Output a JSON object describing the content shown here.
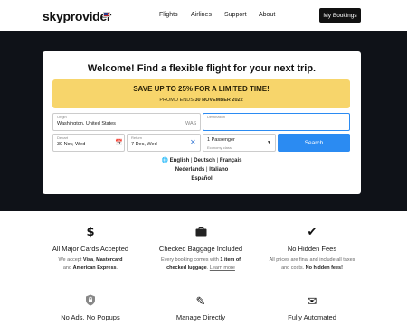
{
  "brand": {
    "name": "skyprovider",
    "flag": "us-flag-icon"
  },
  "nav": {
    "flights": "Flights",
    "airlines": "Airlines",
    "support": "Support",
    "about": "About",
    "my_bookings": "My Bookings"
  },
  "hero": {
    "welcome": "Welcome! Find a flexible flight for your next trip.",
    "promo_title": "SAVE UP TO 25% FOR A LIMITED TIME!",
    "promo_prefix": "PROMO ENDS ",
    "promo_date": "30 NOVEMBER 2022"
  },
  "form": {
    "origin_label": "Origin",
    "origin_value": "Washington, United States",
    "origin_code": "WAS",
    "destination_label": "Destination",
    "destination_value": "",
    "depart_label": "Depart",
    "depart_value": "30 Nov, Wed",
    "return_label": "Return",
    "return_value": "7 Dec, Wed",
    "passengers_value": "1 Passenger",
    "class_value": "Economy class",
    "search_label": "Search"
  },
  "languages": {
    "english": "English",
    "deutsch": "Deutsch",
    "francais": "Français",
    "nederlands": "Nederlands",
    "italiano": "Italiano",
    "espanol": "Español"
  },
  "features": [
    {
      "icon": "dollar-icon",
      "title": "All Major Cards Accepted",
      "d1": "We accept ",
      "b1": "Visa",
      "d2": ", ",
      "b2": "Mastercard",
      "d3": "and ",
      "b3": "American Express",
      "d4": "."
    },
    {
      "icon": "baggage-icon",
      "title": "Checked Baggage Included",
      "d1": "Every booking comes with ",
      "b1": "1 item of",
      "b2": "checked luggage",
      "d2": ". ",
      "link": "Learn more"
    },
    {
      "icon": "checkmark-icon",
      "title": "No Hidden Fees",
      "d1": "All prices are final and include all taxes",
      "d2": "and costs. ",
      "b1": "No hidden fees!"
    },
    {
      "icon": "shield-lock-icon",
      "title": "No Ads, No Popups"
    },
    {
      "icon": "pencil-icon",
      "title": "Manage Directly"
    },
    {
      "icon": "envelope-icon",
      "title": "Fully Automated"
    }
  ]
}
